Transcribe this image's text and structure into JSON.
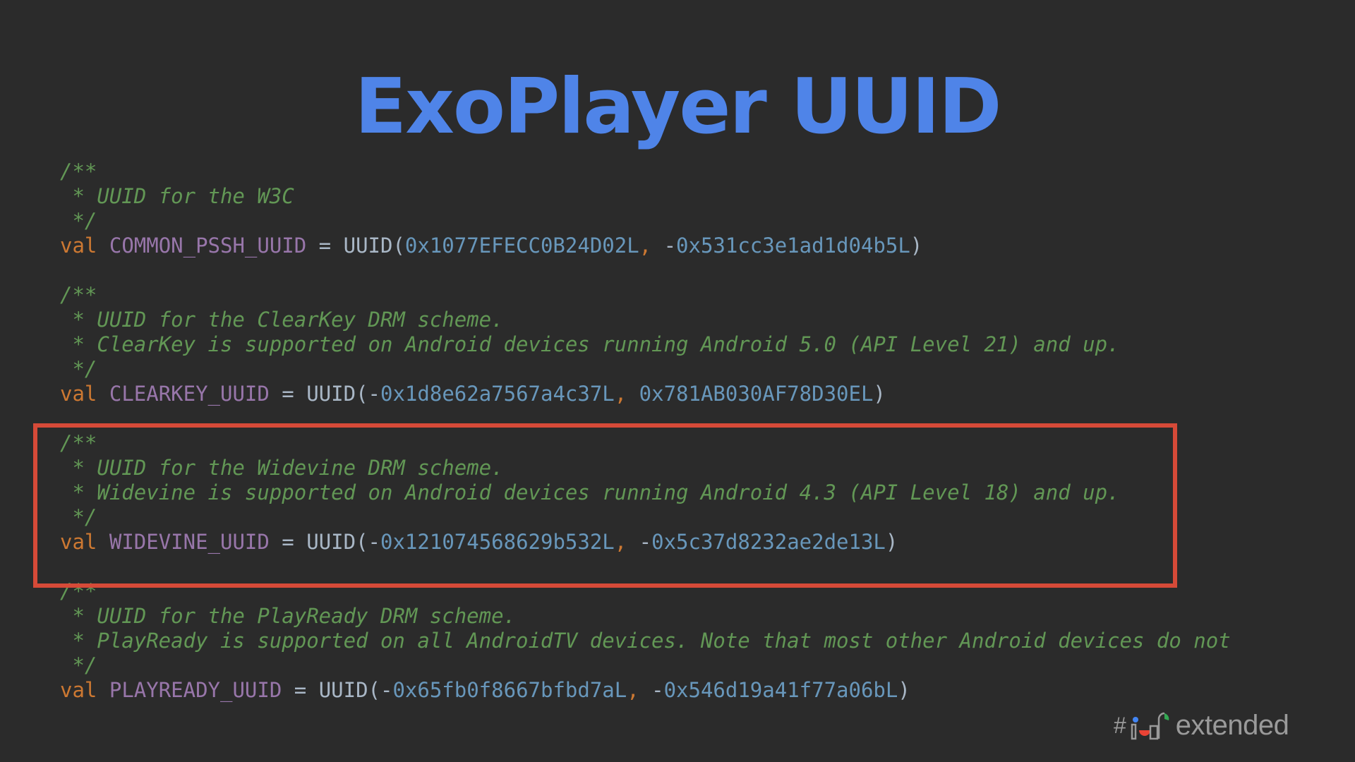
{
  "slide": {
    "title": "ExoPlayer UUID"
  },
  "code": {
    "lines": [
      {
        "comment": "/**"
      },
      {
        "comment": " * UUID for the W3C"
      },
      {
        "comment": " */"
      },
      {
        "keyword": "val",
        "name": "COMMON_PSSH_UUID",
        "eq": " = ",
        "type": "UUID",
        "open": "(",
        "arg1": "0x1077EFECC0B24D02L",
        "sep": ", ",
        "arg2": "-0x531cc3e1ad1d04b5L",
        "close": ")"
      },
      {
        "blank": ""
      },
      {
        "comment": "/**"
      },
      {
        "comment": " * UUID for the ClearKey DRM scheme."
      },
      {
        "comment": " * ClearKey is supported on Android devices running Android 5.0 (API Level 21) and up."
      },
      {
        "comment": " */"
      },
      {
        "keyword": "val",
        "name": "CLEARKEY_UUID",
        "eq": " = ",
        "type": "UUID",
        "open": "(",
        "arg1": "-0x1d8e62a7567a4c37L",
        "sep": ", ",
        "arg2": "0x781AB030AF78D30EL",
        "close": ")"
      },
      {
        "blank": ""
      },
      {
        "comment": "/**"
      },
      {
        "comment": " * UUID for the Widevine DRM scheme."
      },
      {
        "comment": " * Widevine is supported on Android devices running Android 4.3 (API Level 18) and up."
      },
      {
        "comment": " */"
      },
      {
        "keyword": "val",
        "name": "WIDEVINE_UUID",
        "eq": " = ",
        "type": "UUID",
        "open": "(",
        "arg1": "-0x121074568629b532L",
        "sep": ", ",
        "arg2": "-0x5c37d8232ae2de13L",
        "close": ")"
      },
      {
        "blank": ""
      },
      {
        "comment": "/**"
      },
      {
        "comment": " * UUID for the PlayReady DRM scheme."
      },
      {
        "comment": " * PlayReady is supported on all AndroidTV devices. Note that most other Android devices do not"
      },
      {
        "comment": " */"
      },
      {
        "keyword": "val",
        "name": "PLAYREADY_UUID",
        "eq": " = ",
        "type": "UUID",
        "open": "(",
        "arg1": "-0x65fb0f8667bfbd7aL",
        "sep": ", ",
        "arg2": "-0x546d19a41f77a06bL",
        "close": ")"
      }
    ]
  },
  "branding": {
    "hash": "#",
    "text": "extended",
    "logo_colors": [
      "#4285f4",
      "#ea4335",
      "#34a853",
      "#fbbc04"
    ]
  },
  "colors": {
    "background": "#2b2b2b",
    "title": "#4f84e8",
    "highlight_border": "#d64a38",
    "comment": "#629755",
    "keyword": "#cc7832",
    "identifier": "#9876aa",
    "number": "#6897bb"
  }
}
